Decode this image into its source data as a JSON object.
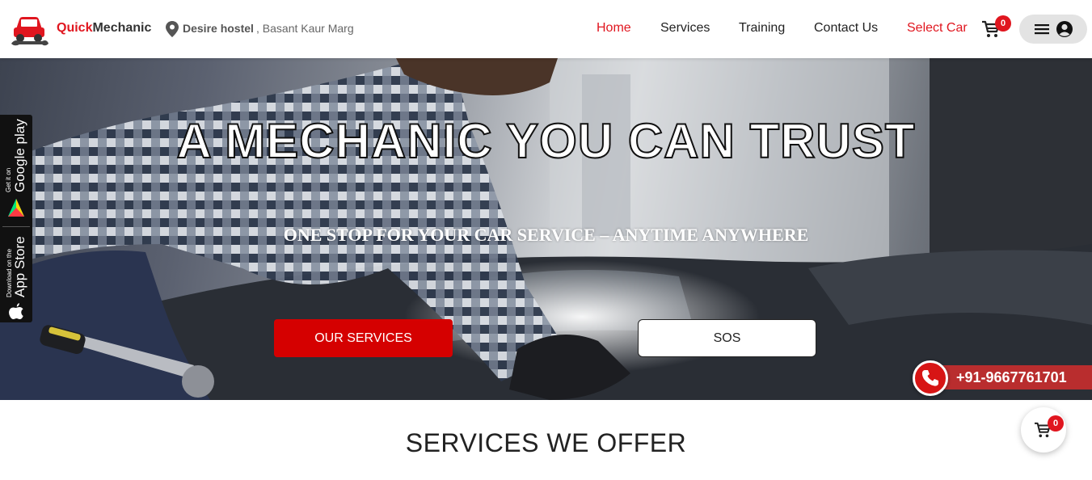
{
  "header": {
    "brand_accent": "Quick",
    "brand_rest": "Mechanic",
    "location_bold": "Desire hostel",
    "location_rest": ", Basant Kaur Marg",
    "nav": {
      "home": "Home",
      "services": "Services",
      "training": "Training",
      "contact": "Contact Us",
      "select_car": "Select Car"
    },
    "cart_count": "0"
  },
  "hero": {
    "title": "A MECHANIC YOU CAN TRUST",
    "subtitle": "ONE STOP FOR YOUR CAR SERVICE – ANYTIME ANYWHERE",
    "primary_button": "OUR SERVICES",
    "secondary_button": "SOS"
  },
  "app_badges": {
    "google_small": "Get it on",
    "google_big": "Google play",
    "apple_small": "Download on the",
    "apple_big": "App Store"
  },
  "contact": {
    "phone": "+91-9667761701"
  },
  "section": {
    "heading": "SERVICES WE OFFER"
  },
  "floating_cart": {
    "count": "0"
  },
  "colors": {
    "accent": "#e0161f",
    "button_red": "#d50000"
  }
}
